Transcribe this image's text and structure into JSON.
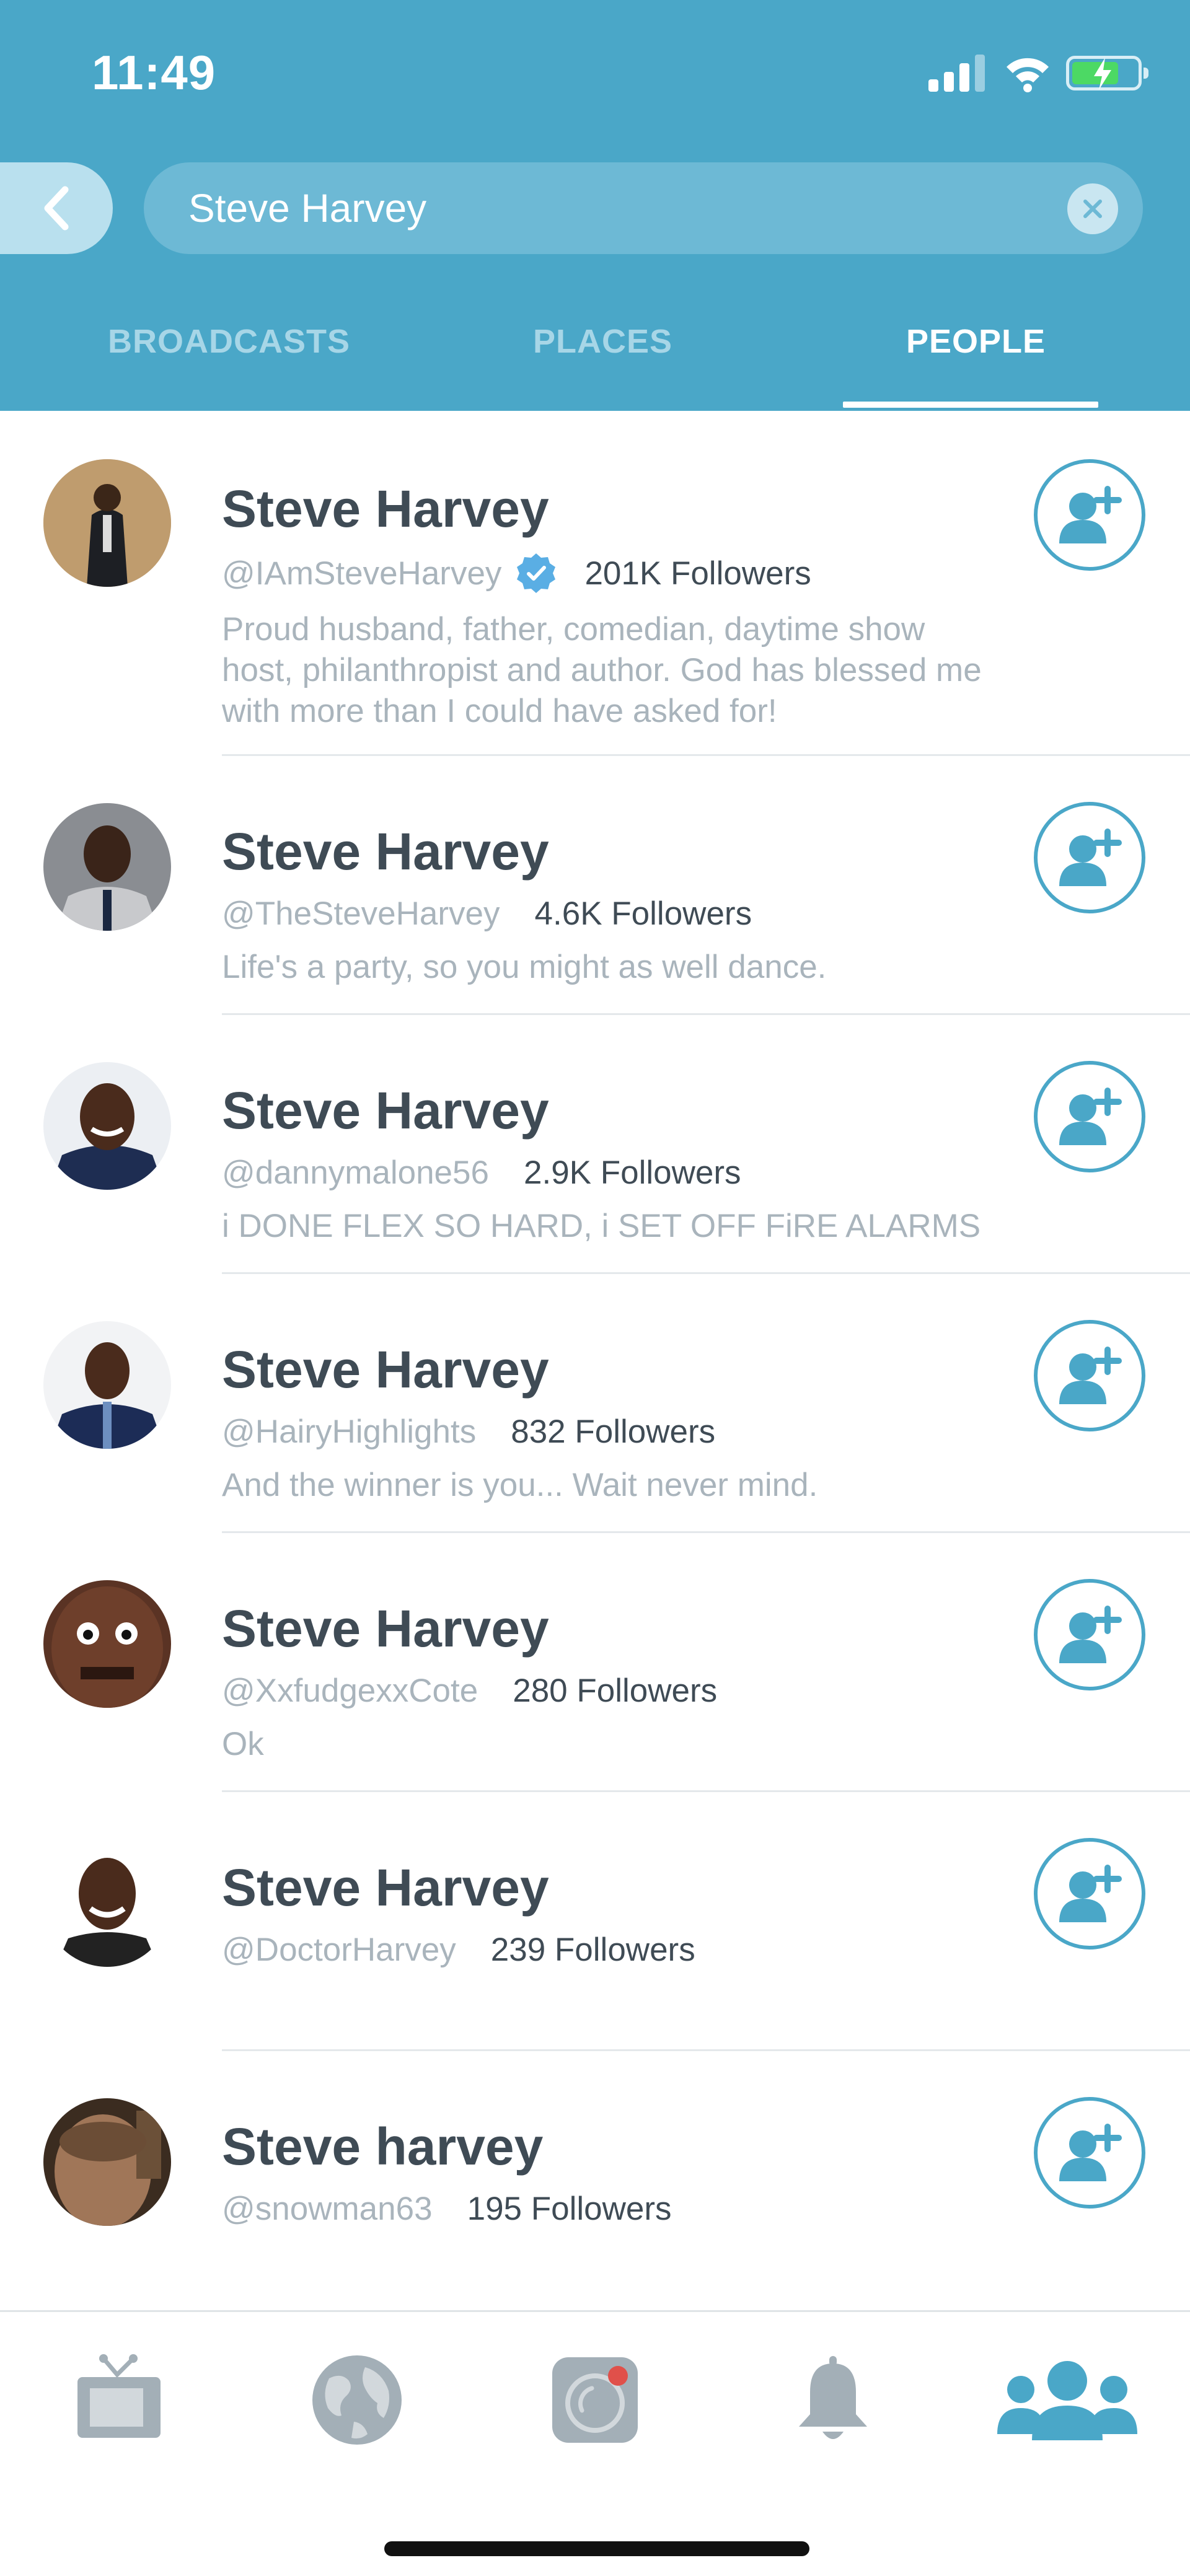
{
  "status_bar": {
    "time": "11:49"
  },
  "search": {
    "query": "Steve Harvey"
  },
  "tabs": [
    {
      "label": "BROADCASTS",
      "active": false
    },
    {
      "label": "PLACES",
      "active": false
    },
    {
      "label": "PEOPLE",
      "active": true
    }
  ],
  "results": [
    {
      "name": "Steve Harvey",
      "handle": "@IAmSteveHarvey",
      "verified": true,
      "followers": "201K Followers",
      "bio": "Proud husband, father, comedian, daytime show host, philanthropist and author. God has blessed me with more than I could have asked for!"
    },
    {
      "name": "Steve Harvey",
      "handle": "@TheSteveHarvey",
      "verified": false,
      "followers": "4.6K Followers",
      "bio": "Life's a party, so you might as well dance."
    },
    {
      "name": "Steve Harvey",
      "handle": "@dannymalone56",
      "verified": false,
      "followers": "2.9K Followers",
      "bio": "i DONE FLEX SO HARD, i SET OFF FiRE ALARMS"
    },
    {
      "name": "Steve Harvey",
      "handle": "@HairyHighlights",
      "verified": false,
      "followers": "832 Followers",
      "bio": "And the winner is you... Wait never mind."
    },
    {
      "name": "Steve Harvey",
      "handle": "@XxfudgexxCote",
      "verified": false,
      "followers": "280 Followers",
      "bio": "Ok"
    },
    {
      "name": "Steve Harvey",
      "handle": "@DoctorHarvey",
      "verified": false,
      "followers": "239 Followers",
      "bio": ""
    },
    {
      "name": "Steve harvey",
      "handle": "@snowman63",
      "verified": false,
      "followers": "195 Followers",
      "bio": ""
    }
  ],
  "colors": {
    "accent": "#4aa7c8",
    "text": "#3f4b55",
    "muted": "#a9b4bc"
  },
  "bottom_nav": [
    "tv-icon",
    "globe-icon",
    "camera-icon",
    "bell-icon",
    "people-icon"
  ],
  "bottom_nav_active": "people-icon"
}
